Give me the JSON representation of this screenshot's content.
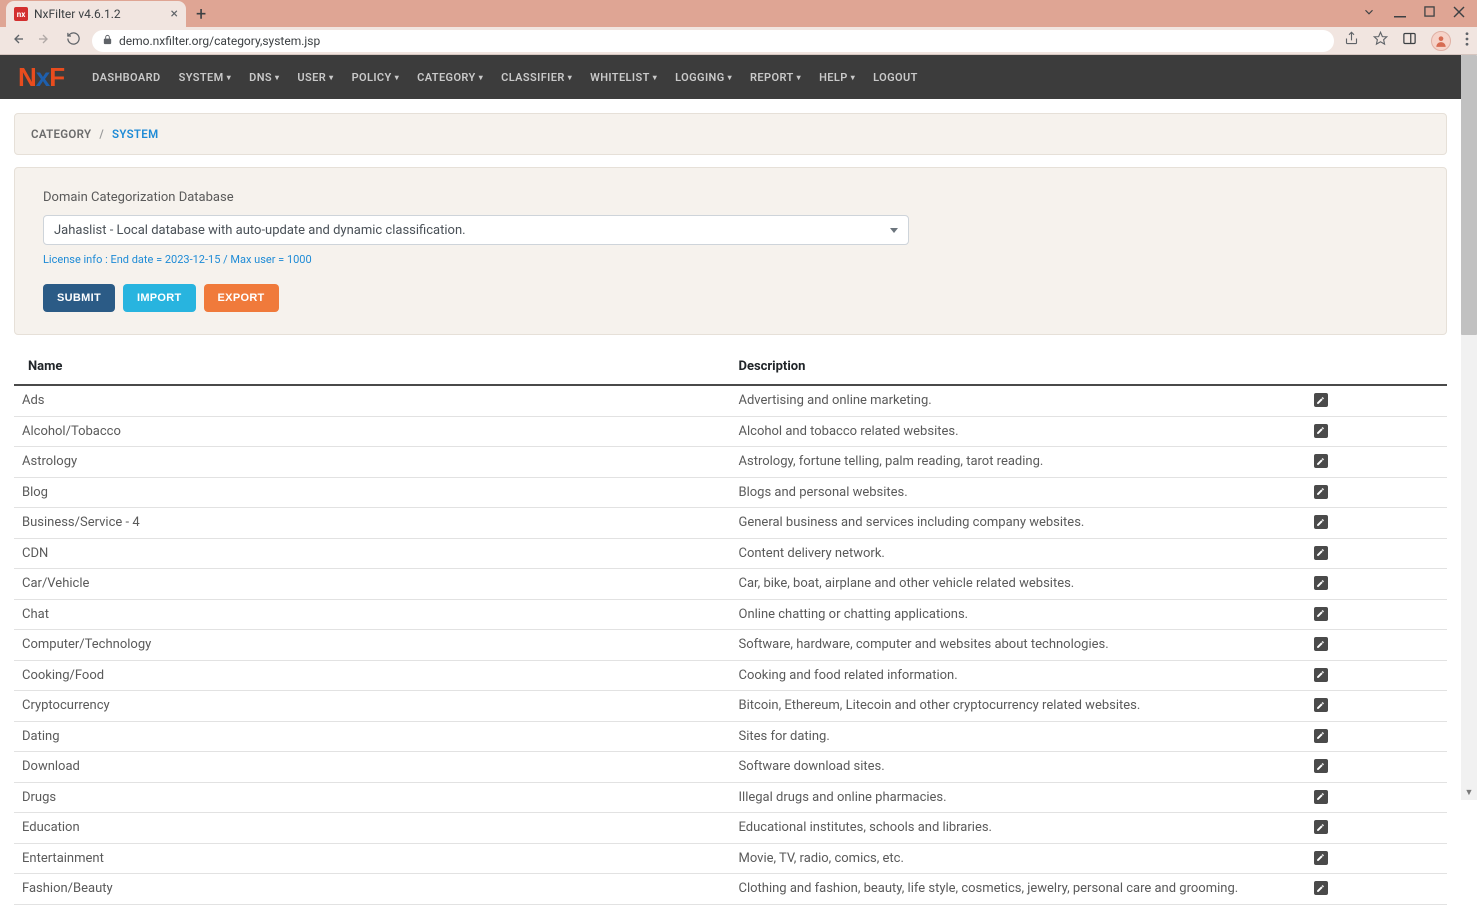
{
  "browser": {
    "tab_title": "NxFilter v4.6.1.2",
    "favicon_letter": "nx",
    "url": "demo.nxfilter.org/category,system.jsp"
  },
  "navbar": {
    "logo_parts": {
      "n": "N",
      "x": "x",
      "f": "F"
    },
    "items": [
      {
        "label": "DASHBOARD",
        "dropdown": false
      },
      {
        "label": "SYSTEM",
        "dropdown": true
      },
      {
        "label": "DNS",
        "dropdown": true
      },
      {
        "label": "USER",
        "dropdown": true
      },
      {
        "label": "POLICY",
        "dropdown": true
      },
      {
        "label": "CATEGORY",
        "dropdown": true
      },
      {
        "label": "CLASSIFIER",
        "dropdown": true
      },
      {
        "label": "WHITELIST",
        "dropdown": true
      },
      {
        "label": "LOGGING",
        "dropdown": true
      },
      {
        "label": "REPORT",
        "dropdown": true
      },
      {
        "label": "HELP",
        "dropdown": true
      },
      {
        "label": "LOGOUT",
        "dropdown": false
      }
    ]
  },
  "breadcrumb": {
    "primary": "CATEGORY",
    "separator": "/",
    "secondary": "SYSTEM"
  },
  "settings": {
    "label": "Domain Categorization Database",
    "selected": "Jahaslist - Local database with auto-update and dynamic classification.",
    "license_info": "License info : End date = 2023-12-15 / Max user = 1000",
    "buttons": {
      "submit": "SUBMIT",
      "import": "IMPORT",
      "export": "EXPORT"
    }
  },
  "table": {
    "headers": {
      "name": "Name",
      "description": "Description"
    },
    "rows": [
      {
        "name": "Ads",
        "description": "Advertising and online marketing."
      },
      {
        "name": "Alcohol/Tobacco",
        "description": "Alcohol and tobacco related websites."
      },
      {
        "name": "Astrology",
        "description": "Astrology, fortune telling, palm reading, tarot reading."
      },
      {
        "name": "Blog",
        "description": "Blogs and personal websites."
      },
      {
        "name": "Business/Service - 4",
        "description": "General business and services including company websites."
      },
      {
        "name": "CDN",
        "description": "Content delivery network."
      },
      {
        "name": "Car/Vehicle",
        "description": "Car, bike, boat, airplane and other vehicle related websites."
      },
      {
        "name": "Chat",
        "description": "Online chatting or chatting applications."
      },
      {
        "name": "Computer/Technology",
        "description": "Software, hardware, computer and websites about technologies."
      },
      {
        "name": "Cooking/Food",
        "description": "Cooking and food related information."
      },
      {
        "name": "Cryptocurrency",
        "description": "Bitcoin, Ethereum, Litecoin and other cryptocurrency related websites."
      },
      {
        "name": "Dating",
        "description": "Sites for dating."
      },
      {
        "name": "Download",
        "description": "Software download sites."
      },
      {
        "name": "Drugs",
        "description": "Illegal drugs and online pharmacies."
      },
      {
        "name": "Education",
        "description": "Educational institutes, schools and libraries."
      },
      {
        "name": "Entertainment",
        "description": "Movie, TV, radio, comics, etc."
      },
      {
        "name": "Fashion/Beauty",
        "description": "Clothing and fashion, beauty, life style, cosmetics, jewelry, personal care and grooming."
      }
    ]
  }
}
